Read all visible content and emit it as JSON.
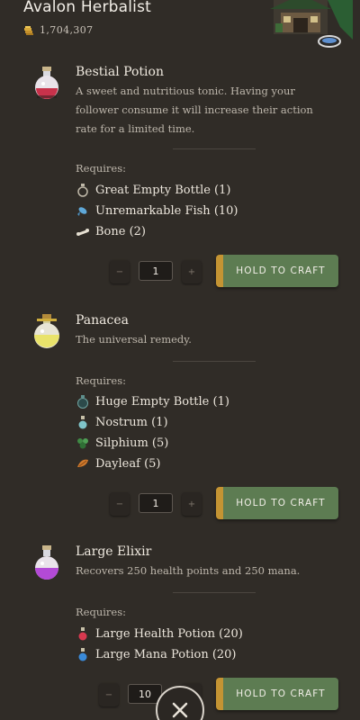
{
  "header": {
    "title": "Avalon Herbalist",
    "coins": "1,704,307"
  },
  "items": [
    {
      "name": "Bestial Potion",
      "desc": "A sweet and nutritious tonic. Having your follower consume it will increase their action rate for a limited time.",
      "requires_label": "Requires:",
      "ingredients": [
        {
          "label": "Great Empty Bottle (1)",
          "icon": "great-empty-bottle-icon"
        },
        {
          "label": "Unremarkable Fish (10)",
          "icon": "fish-icon"
        },
        {
          "label": "Bone (2)",
          "icon": "bone-icon"
        }
      ],
      "quantity": "1",
      "minus": "−",
      "plus": "+",
      "craft_label": "HOLD TO CRAFT"
    },
    {
      "name": "Panacea",
      "desc": "The universal remedy.",
      "requires_label": "Requires:",
      "ingredients": [
        {
          "label": "Huge Empty Bottle (1)",
          "icon": "huge-empty-bottle-icon"
        },
        {
          "label": "Nostrum (1)",
          "icon": "nostrum-icon"
        },
        {
          "label": "Silphium (5)",
          "icon": "silphium-icon"
        },
        {
          "label": "Dayleaf (5)",
          "icon": "dayleaf-icon"
        }
      ],
      "quantity": "1",
      "minus": "−",
      "plus": "+",
      "craft_label": "HOLD TO CRAFT"
    },
    {
      "name": "Large Elixir",
      "desc": "Recovers 250 health points and 250 mana.",
      "requires_label": "Requires:",
      "ingredients": [
        {
          "label": "Large Health Potion (20)",
          "icon": "health-potion-icon"
        },
        {
          "label": "Large Mana Potion (20)",
          "icon": "mana-potion-icon"
        }
      ],
      "quantity": "10",
      "minus": "−",
      "plus": "+",
      "craft_label": "HOLD TO CRAFT"
    }
  ],
  "colors": {
    "background": "#302c27",
    "craft_button": "#5d7c52",
    "craft_accent": "#c49433"
  }
}
